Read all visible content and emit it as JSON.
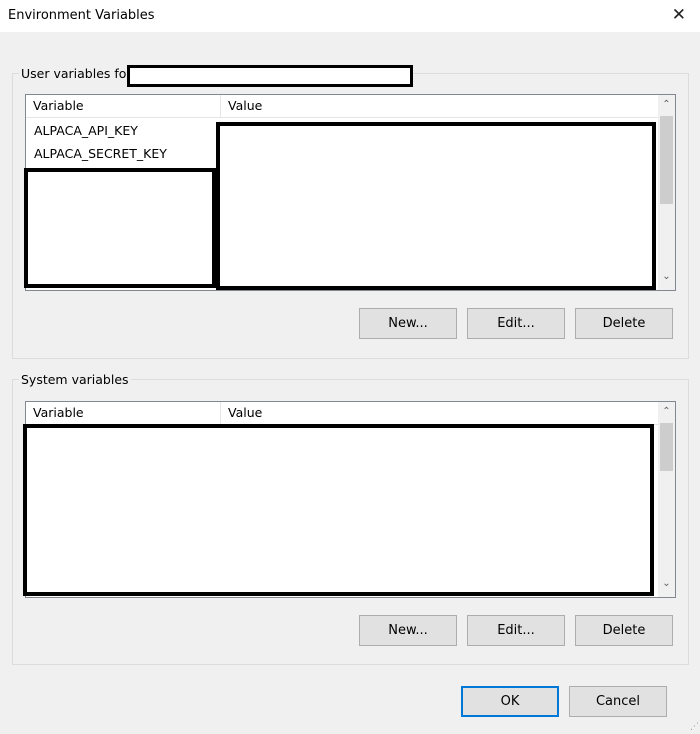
{
  "window": {
    "title": "Environment Variables",
    "close_glyph": "✕"
  },
  "user_group": {
    "label": "User variables for",
    "columns": {
      "variable": "Variable",
      "value": "Value"
    },
    "rows": [
      {
        "variable": "ALPACA_API_KEY"
      },
      {
        "variable": "ALPACA_SECRET_KEY"
      }
    ],
    "buttons": {
      "new": "New...",
      "edit": "Edit...",
      "delete": "Delete"
    }
  },
  "system_group": {
    "label": "System variables",
    "columns": {
      "variable": "Variable",
      "value": "Value"
    },
    "buttons": {
      "new": "New...",
      "edit": "Edit...",
      "delete": "Delete"
    }
  },
  "footer": {
    "ok": "OK",
    "cancel": "Cancel"
  },
  "scroll": {
    "up_glyph": "⌃",
    "down_glyph": "⌄"
  },
  "colors": {
    "default_button_border": "#0078d7",
    "redaction": "#000000"
  }
}
